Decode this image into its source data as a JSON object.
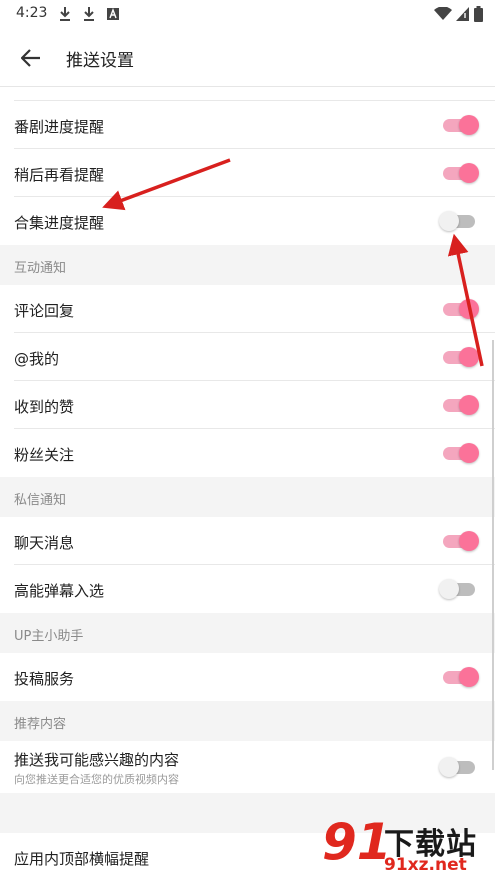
{
  "status_bar": {
    "time": "4:23",
    "right_icons": [
      "wifi-icon",
      "signal-icon",
      "battery-icon"
    ],
    "left_icons": [
      "download-icon",
      "download-icon",
      "a-badge-icon"
    ]
  },
  "toolbar": {
    "title": "推送设置"
  },
  "accent_color": "#fb7299",
  "rows_top": [
    {
      "label": "番剧进度提醒",
      "on": true
    },
    {
      "label": "稍后再看提醒",
      "on": true
    },
    {
      "label": "合集进度提醒",
      "on": false
    }
  ],
  "section_interaction": {
    "title": "互动通知",
    "items": [
      {
        "label": "评论回复",
        "on": true
      },
      {
        "label": "@我的",
        "on": true
      },
      {
        "label": "收到的赞",
        "on": true
      },
      {
        "label": "粉丝关注",
        "on": true
      }
    ]
  },
  "section_messages": {
    "title": "私信通知",
    "items": [
      {
        "label": "聊天消息",
        "on": true
      },
      {
        "label": "高能弹幕入选",
        "on": false
      }
    ]
  },
  "section_up": {
    "title": "UP主小助手",
    "items": [
      {
        "label": "投稿服务",
        "on": true
      }
    ]
  },
  "section_recommend": {
    "title": "推荐内容",
    "items": [
      {
        "label": "推送我可能感兴趣的内容",
        "sub": "向您推送更合适您的优质视频内容",
        "on": false
      }
    ]
  },
  "bottom_row": {
    "label": "应用内顶部横幅提醒"
  },
  "watermark": {
    "big": "91",
    "title": "下载站",
    "url": "91xz.net"
  }
}
